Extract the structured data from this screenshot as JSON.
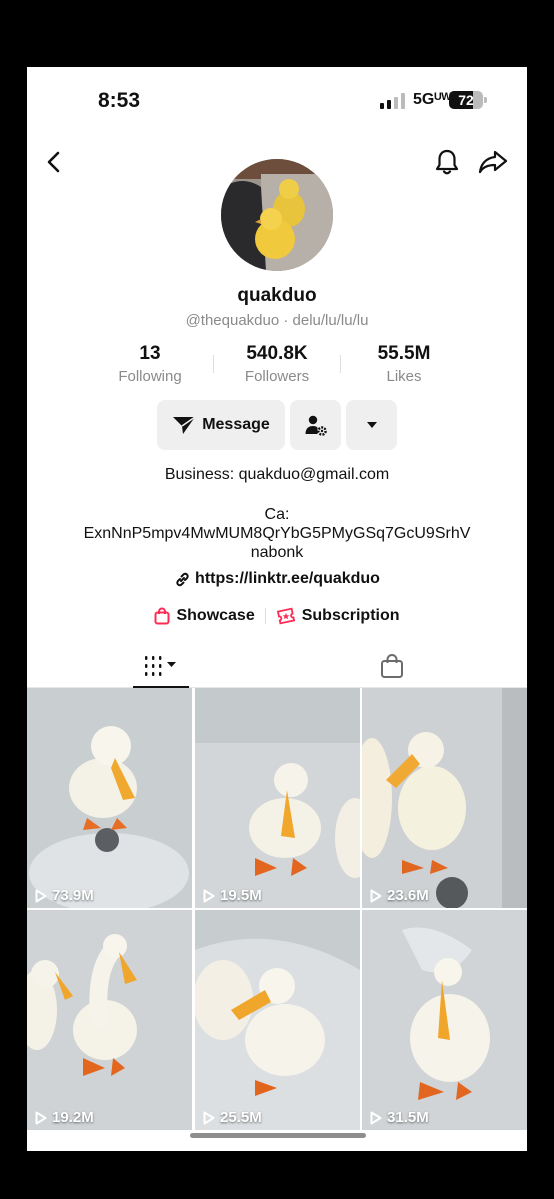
{
  "status": {
    "time": "8:53",
    "network": "5Gᵁᵂ",
    "battery": "72",
    "battery_level": 0.72
  },
  "profile": {
    "username": "quakduo",
    "handle": "@thequakduo · delu/lu/lu/lu",
    "stats": [
      {
        "value": "13",
        "label": "Following"
      },
      {
        "value": "540.8K",
        "label": "Followers"
      },
      {
        "value": "55.5M",
        "label": "Likes"
      }
    ],
    "message_label": "Message",
    "bio_business": "Business: quakduo@gmail.com",
    "bio_ca_title": "Ca:",
    "bio_ca_line1": "ExnNnP5mpv4MwMUM8QrYbG5PMyGSq7GcU9SrhV",
    "bio_ca_line2": "nabonk",
    "link": "https://linktr.ee/quakduo",
    "showcase_label": "Showcase",
    "subscription_label": "Subscription"
  },
  "videos": [
    {
      "views": "73.9M"
    },
    {
      "views": "19.5M"
    },
    {
      "views": "23.6M"
    },
    {
      "views": "19.2M"
    },
    {
      "views": "25.5M"
    },
    {
      "views": "31.5M"
    }
  ],
  "icons": {
    "back": "chevron-left-icon",
    "bell": "bell-icon",
    "share": "share-arrow-icon",
    "message": "send-icon",
    "follow_settings": "person-gear-icon",
    "more": "caret-down-icon",
    "link": "link-icon",
    "showcase": "shopping-bag-icon",
    "subscription": "star-badge-icon",
    "tab_videos": "grid-icon",
    "tab_shop": "bag-icon",
    "play": "play-icon"
  },
  "colors": {
    "accent": "#fe2c55",
    "text": "#111111",
    "muted": "#8a8a8a"
  }
}
